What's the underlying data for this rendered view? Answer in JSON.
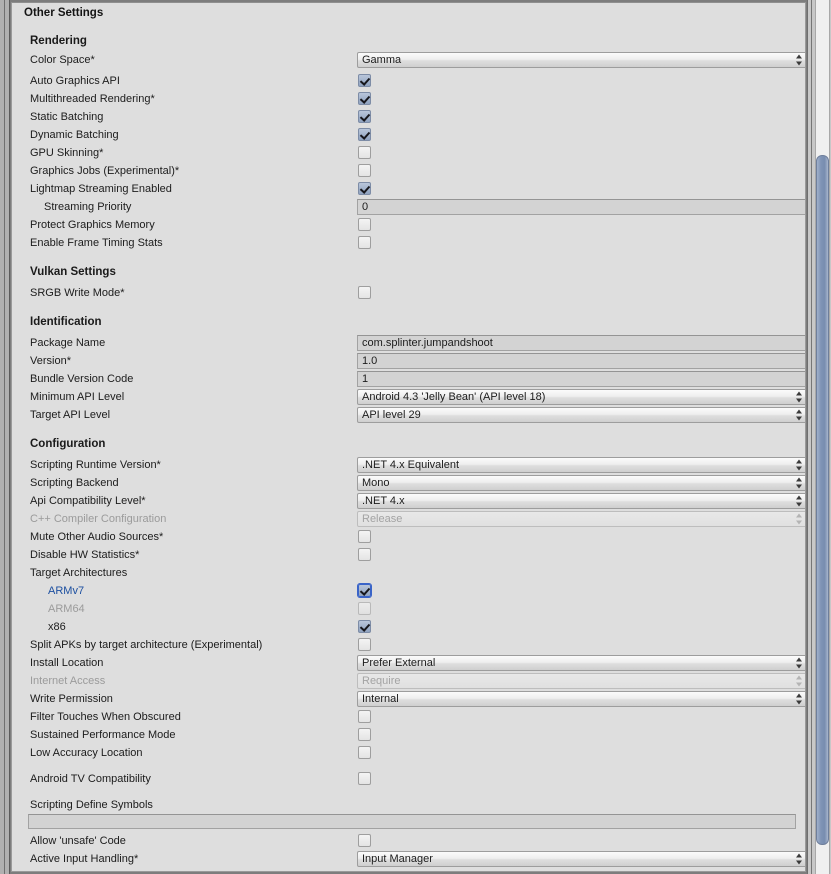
{
  "panel": {
    "title": "Other Settings"
  },
  "sections": {
    "rendering": "Rendering",
    "vulkan": "Vulkan Settings",
    "identification": "Identification",
    "configuration": "Configuration"
  },
  "rows": {
    "color_space": {
      "label": "Color Space*",
      "value": "Gamma"
    },
    "auto_graphics_api": {
      "label": "Auto Graphics API",
      "checked": true
    },
    "multithreaded_rendering": {
      "label": "Multithreaded Rendering*",
      "checked": true
    },
    "static_batching": {
      "label": "Static Batching",
      "checked": true
    },
    "dynamic_batching": {
      "label": "Dynamic Batching",
      "checked": true
    },
    "gpu_skinning": {
      "label": "GPU Skinning*",
      "checked": false
    },
    "graphics_jobs": {
      "label": "Graphics Jobs (Experimental)*",
      "checked": false
    },
    "lightmap_streaming": {
      "label": "Lightmap Streaming Enabled",
      "checked": true
    },
    "streaming_priority": {
      "label": "Streaming Priority",
      "value": "0"
    },
    "protect_graphics_memory": {
      "label": "Protect Graphics Memory",
      "checked": false
    },
    "enable_frame_timing_stats": {
      "label": "Enable Frame Timing Stats",
      "checked": false
    },
    "srgb_write_mode": {
      "label": "SRGB Write Mode*",
      "checked": false
    },
    "package_name": {
      "label": "Package Name",
      "value": "com.splinter.jumpandshoot"
    },
    "version": {
      "label": "Version*",
      "value": "1.0"
    },
    "bundle_version_code": {
      "label": "Bundle Version Code",
      "value": "1"
    },
    "minimum_api_level": {
      "label": "Minimum API Level",
      "value": "Android 4.3 'Jelly Bean' (API level 18)"
    },
    "target_api_level": {
      "label": "Target API Level",
      "value": "API level 29"
    },
    "scripting_runtime_version": {
      "label": "Scripting Runtime Version*",
      "value": ".NET 4.x Equivalent"
    },
    "scripting_backend": {
      "label": "Scripting Backend",
      "value": "Mono"
    },
    "api_compatibility_level": {
      "label": "Api Compatibility Level*",
      "value": ".NET 4.x"
    },
    "cpp_compiler_configuration": {
      "label": "C++ Compiler Configuration",
      "value": "Release"
    },
    "mute_other_audio_sources": {
      "label": "Mute Other Audio Sources*",
      "checked": false
    },
    "disable_hw_statistics": {
      "label": "Disable HW Statistics*",
      "checked": false
    },
    "target_architectures": {
      "label": "Target Architectures"
    },
    "armv7": {
      "label": "ARMv7",
      "checked": true
    },
    "arm64": {
      "label": "ARM64",
      "checked": false
    },
    "x86": {
      "label": "x86",
      "checked": true
    },
    "split_apks": {
      "label": "Split APKs by target architecture (Experimental)",
      "checked": false
    },
    "install_location": {
      "label": "Install Location",
      "value": "Prefer External"
    },
    "internet_access": {
      "label": "Internet Access",
      "value": "Require"
    },
    "write_permission": {
      "label": "Write Permission",
      "value": "Internal"
    },
    "filter_touches": {
      "label": "Filter Touches When Obscured",
      "checked": false
    },
    "sustained_performance_mode": {
      "label": "Sustained Performance Mode",
      "checked": false
    },
    "low_accuracy_location": {
      "label": "Low Accuracy Location",
      "checked": false
    },
    "android_tv_compatibility": {
      "label": "Android TV Compatibility",
      "checked": false
    },
    "scripting_define_symbols": {
      "label": "Scripting Define Symbols",
      "value": ""
    },
    "allow_unsafe_code": {
      "label": "Allow 'unsafe' Code",
      "checked": false
    },
    "active_input_handling": {
      "label": "Active Input Handling*",
      "value": "Input Manager"
    }
  },
  "colors": {
    "panel_bg": "#dedede",
    "checkbox_checked": "#8fa2bf",
    "selected_label": "#1c4fa0",
    "disabled_label": "#9b9b9b",
    "scrollbar_thumb": "#8094b6"
  }
}
